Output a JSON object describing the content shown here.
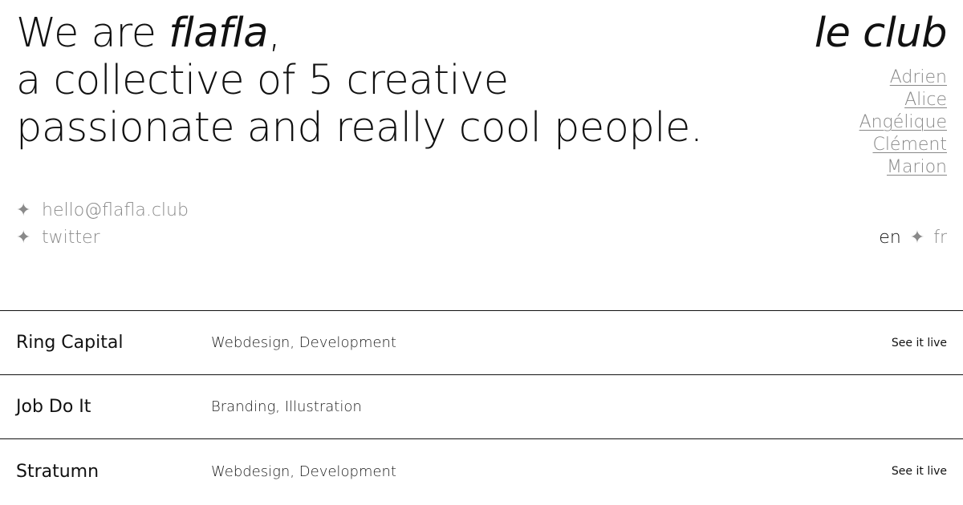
{
  "hero": {
    "line1_prefix": "We are ",
    "line1_name": "flafla",
    "line1_suffix": ",",
    "line2": "a collective of 5 creative",
    "line3": "passionate and really cool  people."
  },
  "club": {
    "title": "le club",
    "members": [
      "Adrien",
      "Alice",
      "Angélique",
      "Clément",
      "Marion"
    ]
  },
  "contacts": {
    "bullet": "✦",
    "email": "hello@flafla.club",
    "twitter": "twitter"
  },
  "language": {
    "active": "en",
    "separator": "✦",
    "other": "fr"
  },
  "projects": [
    {
      "name": "Ring Capital",
      "tags": "Webdesign, Development",
      "link": "See it live"
    },
    {
      "name": "Job Do It",
      "tags": "Branding, Illustration",
      "link": ""
    },
    {
      "name": "Stratumn",
      "tags": "Webdesign, Development",
      "link": "See it live"
    }
  ]
}
